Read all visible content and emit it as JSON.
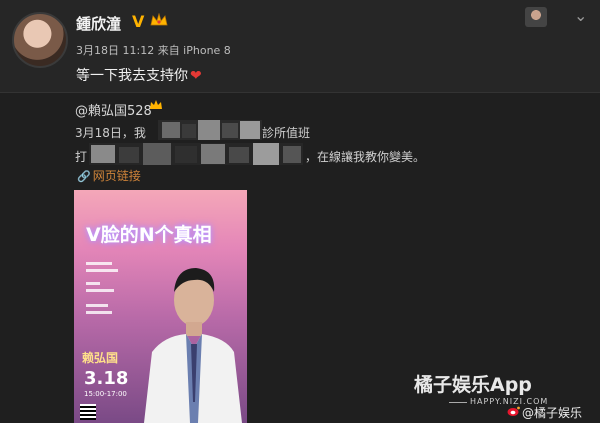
{
  "post": {
    "author": "鍾欣潼",
    "verified_badge": "V",
    "time": "3月18日 11:12 来自 iPhone 8",
    "text": "等一下我去支持你",
    "heart_icon": "❤"
  },
  "repost": {
    "author": "@賴弘国528",
    "line1_start": "3月18日，我",
    "line1_end": "診所值班",
    "line2_start": "打",
    "line2_end": "，在線讓我教你變美。",
    "link_icon": "🔗",
    "link_label": "网页链接"
  },
  "poster": {
    "title": "V脸的N个真相",
    "name": "赖弘国",
    "date": "3.18",
    "time": "15:00-17:00"
  },
  "watermark": {
    "app": "橘子娱乐App",
    "url": "HAPPY.NIZI.COM",
    "handle": "@橘子娱乐"
  },
  "colors": {
    "background": "#232323",
    "link": "#d0843a",
    "verified": "#ffb300",
    "heart": "#e53935"
  }
}
